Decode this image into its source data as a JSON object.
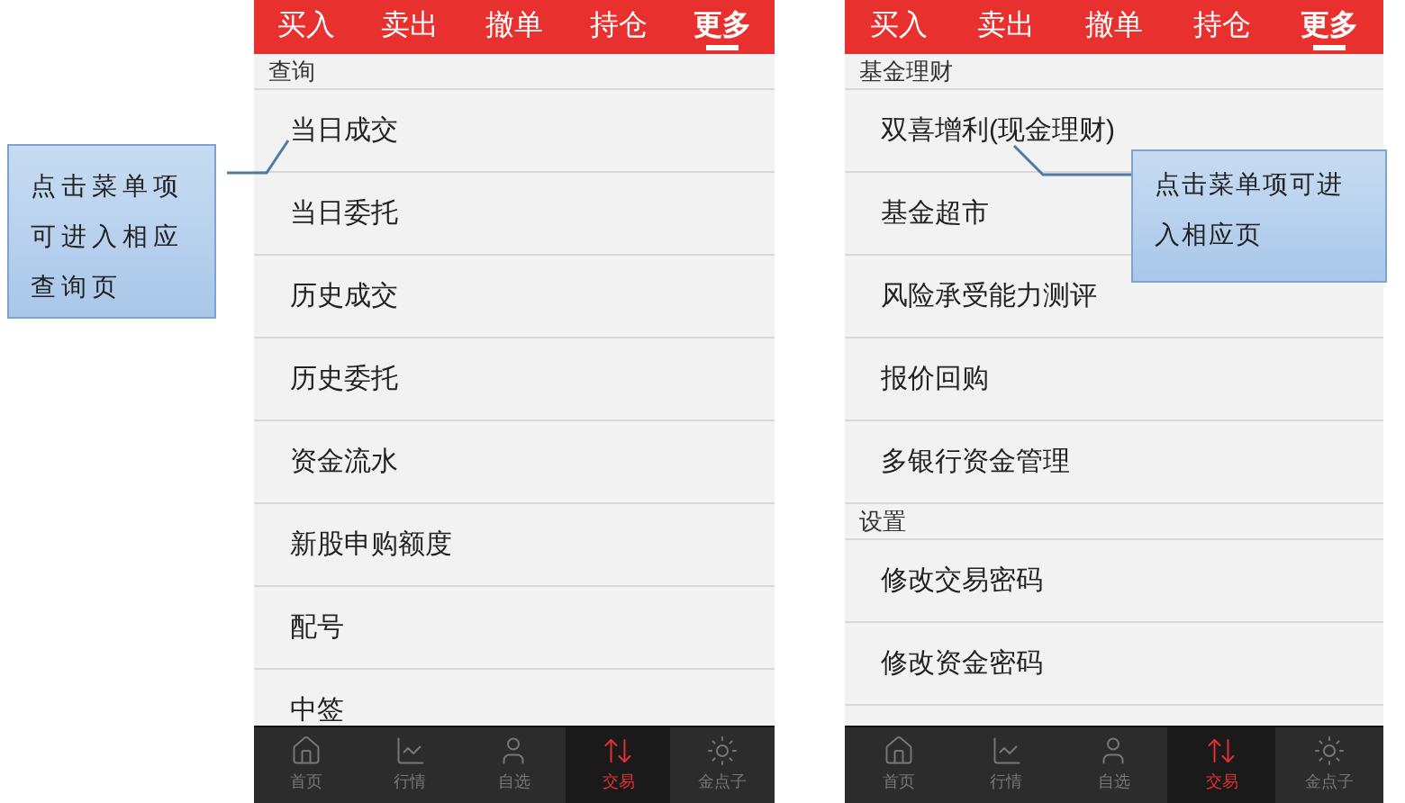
{
  "phones": [
    {
      "tabs": [
        {
          "label": "买入",
          "selected": false
        },
        {
          "label": "卖出",
          "selected": false
        },
        {
          "label": "撤单",
          "selected": false
        },
        {
          "label": "持仓",
          "selected": false
        },
        {
          "label": "更多",
          "selected": true
        }
      ],
      "sections": [
        {
          "title": "查询",
          "items": [
            "当日成交",
            "当日委托",
            "历史成交",
            "历史委托",
            "资金流水",
            "新股申购额度",
            "配号",
            "中签"
          ]
        }
      ],
      "nav": [
        {
          "label": "首页",
          "selected": false
        },
        {
          "label": "行情",
          "selected": false
        },
        {
          "label": "自选",
          "selected": false
        },
        {
          "label": "交易",
          "selected": true
        },
        {
          "label": "金点子",
          "selected": false
        }
      ]
    },
    {
      "tabs": [
        {
          "label": "买入",
          "selected": false
        },
        {
          "label": "卖出",
          "selected": false
        },
        {
          "label": "撤单",
          "selected": false
        },
        {
          "label": "持仓",
          "selected": false
        },
        {
          "label": "更多",
          "selected": true
        }
      ],
      "sections": [
        {
          "title": "基金理财",
          "items": [
            "双喜增利(现金理财)",
            "基金超市",
            "风险承受能力测评",
            "报价回购",
            "多银行资金管理"
          ]
        },
        {
          "title": "设置",
          "items": [
            "修改交易密码",
            "修改资金密码"
          ]
        }
      ],
      "nav": [
        {
          "label": "首页",
          "selected": false
        },
        {
          "label": "行情",
          "selected": false
        },
        {
          "label": "自选",
          "selected": false
        },
        {
          "label": "交易",
          "selected": true
        },
        {
          "label": "金点子",
          "selected": false
        }
      ]
    }
  ],
  "callouts": [
    {
      "text": "点击菜单项可进入相应查询页"
    },
    {
      "text": "点击菜单项可进入相应页"
    }
  ]
}
